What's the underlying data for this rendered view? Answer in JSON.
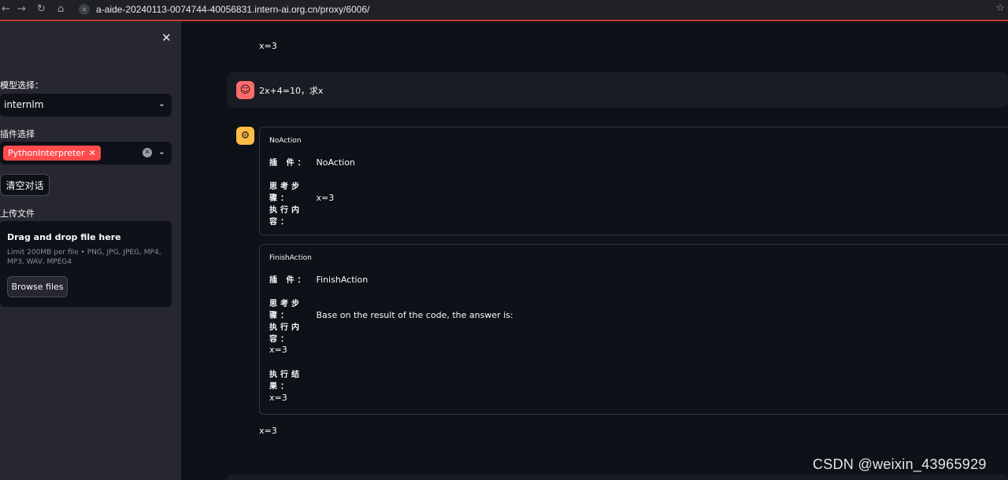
{
  "browser": {
    "url": "a-aide-20240113-0074744-40056831.intern-ai.org.cn/proxy/6006/"
  },
  "sidebar": {
    "model_label": "模型选择：",
    "model_value": "internlm",
    "plugin_label": "插件选择",
    "plugin_chip": "PythonInterpreter",
    "clear_button": "清空对话",
    "upload_label": "上传文件",
    "upload_title": "Drag and drop file here",
    "upload_limit": "Limit 200MB per file • PNG, JPG, JPEG, MP4, MP3, WAV, MPEG4",
    "browse_button": "Browse files"
  },
  "chat": {
    "previous_text": "x=3",
    "user_message": "2x+4=10，求x",
    "cards": [
      {
        "title": "NoAction",
        "plugin_key": "插 件：",
        "plugin_value": "NoAction",
        "thought_key": "思考步骤：",
        "thought_value": "x=3",
        "exec_key": "执行内容："
      },
      {
        "title": "FinishAction",
        "plugin_key": "插 件：",
        "plugin_value": "FinishAction",
        "thought_key": "思考步骤：",
        "thought_value": "Base on the result of the code, the answer is:",
        "exec_key": "执行内容：",
        "exec_value": "x=3",
        "result_key": "执行结果：",
        "result_value": "x=3"
      }
    ],
    "final_answer": "x=3"
  },
  "watermark": "CSDN @weixin_43965929",
  "colors": {
    "accent": "#ff4b4b",
    "sidebar_bg": "#262730",
    "main_bg": "#0e1117",
    "bot_avatar": "#ffbd45",
    "user_avatar": "#ff6b6b"
  }
}
